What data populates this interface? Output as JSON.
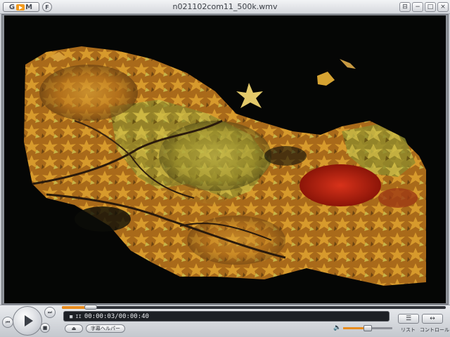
{
  "app": {
    "logo_text": "GOM",
    "menu_label": "F",
    "window_title": "n021102com11_500k.wmv"
  },
  "window_buttons": {
    "restore": "⊟",
    "minimize": "−",
    "maximize": "□",
    "close": "×"
  },
  "video": {
    "scene": "autumn maple leaves on dark background",
    "colors": {
      "leaf_orange": "#d07a1c",
      "leaf_yellow": "#c9b03a",
      "leaf_red": "#b81e12",
      "sky": "#050605"
    }
  },
  "playback": {
    "status_indicator": "■ II",
    "time_display": "00:00:03/00:00:40",
    "position_fraction": 0.075,
    "volume_fraction": 0.5
  },
  "controls": {
    "prev_icon": "⏮",
    "next_icon": "⏭",
    "stop_icon": "■",
    "eject_icon": "⏏",
    "subtitle_helper_label": "字幕ヘルパー",
    "list_label": "リスト",
    "control_label": "コントロール",
    "list_button_icon": "☰",
    "control_button_icon": "↔"
  },
  "accent_color": "#e88c1e"
}
